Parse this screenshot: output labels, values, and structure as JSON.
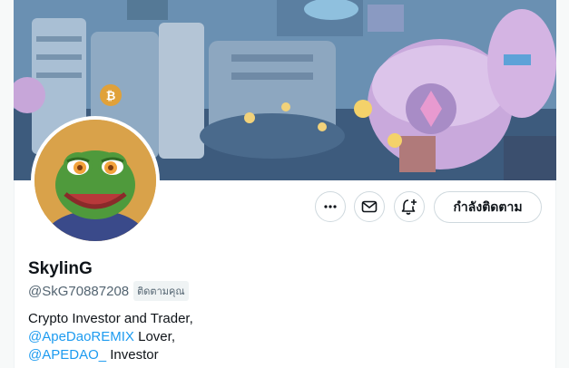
{
  "profile": {
    "banner_icon": "nft-city-artwork",
    "avatar_icon": "pepe-frog-avatar",
    "name": "SkylinG",
    "handle": "@SkG70887208",
    "follows_you_badge": "ติดตามคุณ",
    "bio": {
      "line1": "Crypto Investor and Trader,",
      "line2_link": "@ApeDaoREMIX",
      "line2_text": " Lover,",
      "line3_link": "@APEDAO_",
      "line3_text": " Investor"
    }
  },
  "actions": {
    "more_icon": "more-dots-icon",
    "message_icon": "envelope-icon",
    "notify_icon": "bell-plus-icon",
    "follow_label": "กำลังติดตาม"
  },
  "colors": {
    "link": "#1d9bf0",
    "text_primary": "#0f1419",
    "text_secondary": "#536471",
    "border": "#cfd9de"
  }
}
